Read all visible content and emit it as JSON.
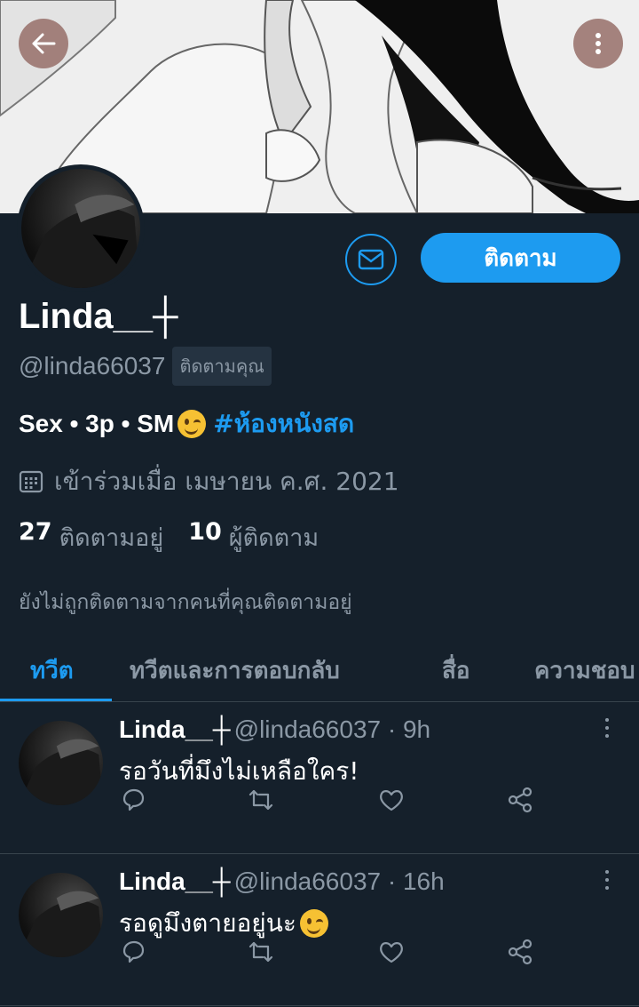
{
  "header": {
    "back_icon": "arrow-left-icon",
    "more_icon": "more-vertical-icon"
  },
  "profile": {
    "display_name": "Linda__┼",
    "handle": "@linda66037",
    "follows_you": "ติดตามคุณ",
    "follow_label": "ติดตาม",
    "bio_text": "Sex • 3p • SM",
    "bio_hashtag": "#ห้องหนังสด",
    "joined": "เข้าร่วมเมื่อ เมษายน ค.ศ. 2021",
    "following_count": "27",
    "following_label": "ติดตามอยู่",
    "followers_count": "10",
    "followers_label": "ผู้ติดตาม",
    "not_followed_note": "ยังไม่ถูกติดตามจากคนที่คุณติดตามอยู่"
  },
  "tabs": [
    {
      "label": "ทวีต",
      "active": true
    },
    {
      "label": "ทวีตและการตอบกลับ",
      "active": false
    },
    {
      "label": "สื่อ",
      "active": false
    },
    {
      "label": "ความชอบ",
      "active": false
    }
  ],
  "tweets": [
    {
      "name": "Linda__┼",
      "meta": "@linda66037 · 9h",
      "text": "รอวันที่มึงไม่เหลือใคร!"
    },
    {
      "name": "Linda__┼",
      "meta": "@linda66037 · 16h",
      "text": "รอดูมึงตายอยู่นะ"
    }
  ],
  "colors": {
    "background": "#15202b",
    "accent": "#1d9bf0",
    "muted": "#8b98a5",
    "divider": "#38444d"
  }
}
